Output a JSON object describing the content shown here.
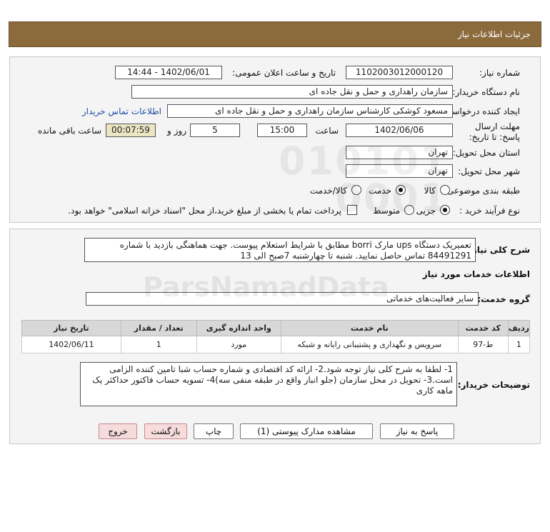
{
  "header": {
    "title": "جزئیات اطلاعات نیاز"
  },
  "form": {
    "need_number_label": "شماره نیاز:",
    "need_number": "1102003012000120",
    "announce_label": "تاریخ و ساعت اعلان عمومی:",
    "announce_value": "1402/06/01 - 14:44",
    "buyer_org_label": "نام دستگاه خریدار:",
    "buyer_org": "سازمان راهداری و حمل و نقل جاده ای",
    "creator_label": "ایجاد کننده درخواست:",
    "creator": "مسعود کوشکی کارشناس  سازمان راهداری و حمل و نقل جاده ای",
    "contact_link": "اطلاعات تماس خریدار",
    "deadline_label": "مهلت ارسال پاسخ: تا تاریخ:",
    "deadline_date": "1402/06/06",
    "time_label": "ساعت",
    "deadline_time": "15:00",
    "days_value": "5",
    "days_label": "روز و",
    "remaining_time": "00:07:59",
    "remaining_label": "ساعت باقی مانده",
    "province_label": "استان محل تحویل:",
    "province": "تهران",
    "city_label": "شهر محل تحویل:",
    "city": "تهران",
    "category_label": "طبقه بندی موضوعی:",
    "category_options": [
      "کالا",
      "خدمت",
      "کالا/خدمت"
    ],
    "category_selected": "خدمت",
    "process_label": "نوع فرآیند خرید :",
    "process_options": [
      "جزیی",
      "متوسط"
    ],
    "process_selected": "جزیی",
    "treasury_note": "پرداخت تمام یا بخشی از مبلغ خرید،از محل \"اسناد خزانه اسلامی\" خواهد بود."
  },
  "details": {
    "description_label": "شرح کلی نیاز:",
    "description": "تعمیریک دستگاه ups مارک borri  مطابق با شرایط استعلام پیوست. جهت هماهنگی بازدید با شماره 84491291 تماس حاصل نمایید. شنبه تا چهارشنبه 7صبح الی 13",
    "services_title": "اطلاعات خدمات مورد نیاز",
    "service_group_label": "گروه خدمت:",
    "service_group": "سایر فعالیت‌های خدماتی",
    "table": {
      "headers": [
        "ردیف",
        "کد خدمت",
        "نام خدمت",
        "واحد اندازه گیری",
        "تعداد / مقدار",
        "تاریخ نیاز"
      ],
      "rows": [
        [
          "1",
          "ط-97",
          "سرویس و نگهداری و پشتیبانی رایانه و شبکه",
          "مورد",
          "1",
          "1402/06/11"
        ]
      ]
    },
    "buyer_notes_label": "توضیحات خریدار:",
    "buyer_notes": "1- لطفا به شرح کلی نیاز توجه شود.2- ارائه کد اقتصادی و شماره حساب شبا تامین کننده الزامی است.3- تحویل در محل سازمان (جلو انبار واقع در طبقه منفی سه)4- تسویه حساب فاکتور حداکثر یک ماهه کاری"
  },
  "buttons": {
    "reply": "پاسخ به نیاز",
    "view_docs": "مشاهده مدارک پیوستی (1)",
    "print": "چاپ",
    "back": "بازگشت",
    "exit": "خروج"
  },
  "watermark": {
    "digits_line1": "010101",
    "digits_line2": "0001",
    "brand": "ParsNamadData"
  }
}
